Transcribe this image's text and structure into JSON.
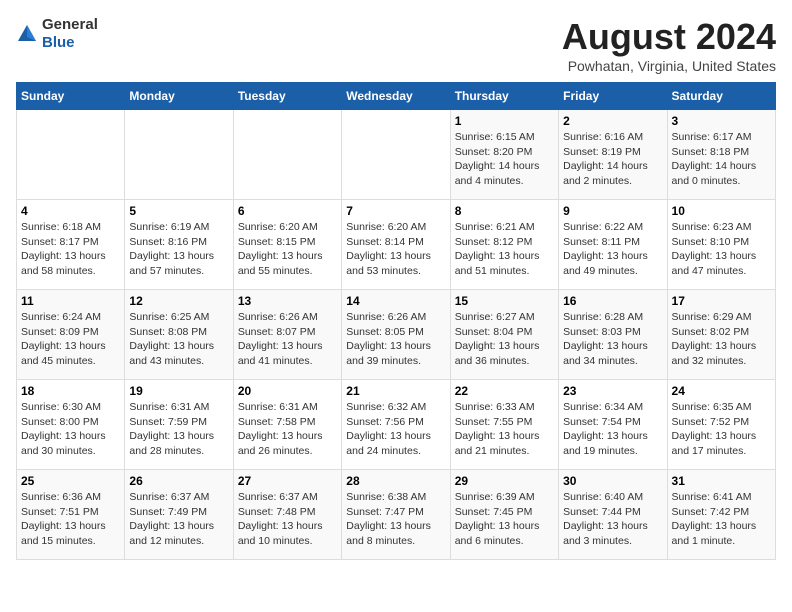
{
  "header": {
    "logo_general": "General",
    "logo_blue": "Blue",
    "title": "August 2024",
    "subtitle": "Powhatan, Virginia, United States"
  },
  "days_of_week": [
    "Sunday",
    "Monday",
    "Tuesday",
    "Wednesday",
    "Thursday",
    "Friday",
    "Saturday"
  ],
  "weeks": [
    [
      {
        "day": "",
        "info": ""
      },
      {
        "day": "",
        "info": ""
      },
      {
        "day": "",
        "info": ""
      },
      {
        "day": "",
        "info": ""
      },
      {
        "day": "1",
        "info": "Sunrise: 6:15 AM\nSunset: 8:20 PM\nDaylight: 14 hours\nand 4 minutes."
      },
      {
        "day": "2",
        "info": "Sunrise: 6:16 AM\nSunset: 8:19 PM\nDaylight: 14 hours\nand 2 minutes."
      },
      {
        "day": "3",
        "info": "Sunrise: 6:17 AM\nSunset: 8:18 PM\nDaylight: 14 hours\nand 0 minutes."
      }
    ],
    [
      {
        "day": "4",
        "info": "Sunrise: 6:18 AM\nSunset: 8:17 PM\nDaylight: 13 hours\nand 58 minutes."
      },
      {
        "day": "5",
        "info": "Sunrise: 6:19 AM\nSunset: 8:16 PM\nDaylight: 13 hours\nand 57 minutes."
      },
      {
        "day": "6",
        "info": "Sunrise: 6:20 AM\nSunset: 8:15 PM\nDaylight: 13 hours\nand 55 minutes."
      },
      {
        "day": "7",
        "info": "Sunrise: 6:20 AM\nSunset: 8:14 PM\nDaylight: 13 hours\nand 53 minutes."
      },
      {
        "day": "8",
        "info": "Sunrise: 6:21 AM\nSunset: 8:12 PM\nDaylight: 13 hours\nand 51 minutes."
      },
      {
        "day": "9",
        "info": "Sunrise: 6:22 AM\nSunset: 8:11 PM\nDaylight: 13 hours\nand 49 minutes."
      },
      {
        "day": "10",
        "info": "Sunrise: 6:23 AM\nSunset: 8:10 PM\nDaylight: 13 hours\nand 47 minutes."
      }
    ],
    [
      {
        "day": "11",
        "info": "Sunrise: 6:24 AM\nSunset: 8:09 PM\nDaylight: 13 hours\nand 45 minutes."
      },
      {
        "day": "12",
        "info": "Sunrise: 6:25 AM\nSunset: 8:08 PM\nDaylight: 13 hours\nand 43 minutes."
      },
      {
        "day": "13",
        "info": "Sunrise: 6:26 AM\nSunset: 8:07 PM\nDaylight: 13 hours\nand 41 minutes."
      },
      {
        "day": "14",
        "info": "Sunrise: 6:26 AM\nSunset: 8:05 PM\nDaylight: 13 hours\nand 39 minutes."
      },
      {
        "day": "15",
        "info": "Sunrise: 6:27 AM\nSunset: 8:04 PM\nDaylight: 13 hours\nand 36 minutes."
      },
      {
        "day": "16",
        "info": "Sunrise: 6:28 AM\nSunset: 8:03 PM\nDaylight: 13 hours\nand 34 minutes."
      },
      {
        "day": "17",
        "info": "Sunrise: 6:29 AM\nSunset: 8:02 PM\nDaylight: 13 hours\nand 32 minutes."
      }
    ],
    [
      {
        "day": "18",
        "info": "Sunrise: 6:30 AM\nSunset: 8:00 PM\nDaylight: 13 hours\nand 30 minutes."
      },
      {
        "day": "19",
        "info": "Sunrise: 6:31 AM\nSunset: 7:59 PM\nDaylight: 13 hours\nand 28 minutes."
      },
      {
        "day": "20",
        "info": "Sunrise: 6:31 AM\nSunset: 7:58 PM\nDaylight: 13 hours\nand 26 minutes."
      },
      {
        "day": "21",
        "info": "Sunrise: 6:32 AM\nSunset: 7:56 PM\nDaylight: 13 hours\nand 24 minutes."
      },
      {
        "day": "22",
        "info": "Sunrise: 6:33 AM\nSunset: 7:55 PM\nDaylight: 13 hours\nand 21 minutes."
      },
      {
        "day": "23",
        "info": "Sunrise: 6:34 AM\nSunset: 7:54 PM\nDaylight: 13 hours\nand 19 minutes."
      },
      {
        "day": "24",
        "info": "Sunrise: 6:35 AM\nSunset: 7:52 PM\nDaylight: 13 hours\nand 17 minutes."
      }
    ],
    [
      {
        "day": "25",
        "info": "Sunrise: 6:36 AM\nSunset: 7:51 PM\nDaylight: 13 hours\nand 15 minutes."
      },
      {
        "day": "26",
        "info": "Sunrise: 6:37 AM\nSunset: 7:49 PM\nDaylight: 13 hours\nand 12 minutes."
      },
      {
        "day": "27",
        "info": "Sunrise: 6:37 AM\nSunset: 7:48 PM\nDaylight: 13 hours\nand 10 minutes."
      },
      {
        "day": "28",
        "info": "Sunrise: 6:38 AM\nSunset: 7:47 PM\nDaylight: 13 hours\nand 8 minutes."
      },
      {
        "day": "29",
        "info": "Sunrise: 6:39 AM\nSunset: 7:45 PM\nDaylight: 13 hours\nand 6 minutes."
      },
      {
        "day": "30",
        "info": "Sunrise: 6:40 AM\nSunset: 7:44 PM\nDaylight: 13 hours\nand 3 minutes."
      },
      {
        "day": "31",
        "info": "Sunrise: 6:41 AM\nSunset: 7:42 PM\nDaylight: 13 hours\nand 1 minute."
      }
    ]
  ]
}
